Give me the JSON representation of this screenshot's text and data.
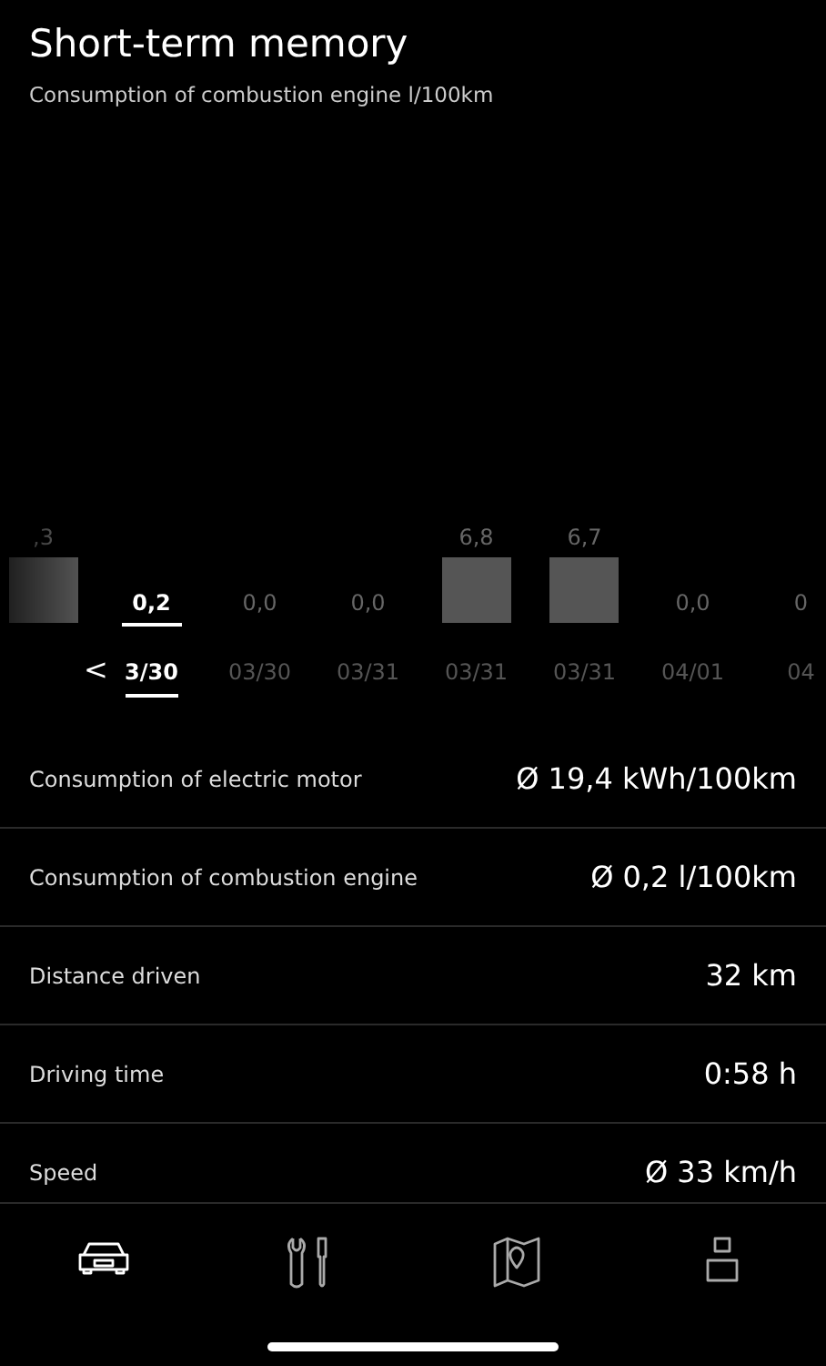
{
  "header": {
    "title": "Short-term memory",
    "subtitle": "Consumption of combustion engine l/100km"
  },
  "chart": {
    "previous_button": "<",
    "bars": [
      {
        "kind": "bar",
        "value": ",3",
        "selected": false
      },
      {
        "kind": "empty",
        "value": "0,2",
        "date": "3/30",
        "selected": true
      },
      {
        "kind": "empty",
        "value": "0,0",
        "date": "03/30",
        "selected": false
      },
      {
        "kind": "empty",
        "value": "0,0",
        "date": "03/31",
        "selected": false
      },
      {
        "kind": "bar",
        "value": "6,8",
        "date": "03/31",
        "selected": false
      },
      {
        "kind": "bar",
        "value": "6,7",
        "date": "03/31",
        "selected": false
      },
      {
        "kind": "empty",
        "value": "0,0",
        "date": "04/01",
        "selected": false
      },
      {
        "kind": "empty",
        "value": "0",
        "date": "04",
        "selected": false
      }
    ]
  },
  "stats": [
    {
      "label": "Consumption of electric motor",
      "value": "Ø 19,4 kWh/100km"
    },
    {
      "label": "Consumption of combustion engine",
      "value": "Ø 0,2 l/100km"
    },
    {
      "label": "Distance driven",
      "value": "32 km"
    },
    {
      "label": "Driving time",
      "value": "0:58 h"
    },
    {
      "label": "Speed",
      "value": "Ø 33 km/h"
    }
  ],
  "tab_bar": [
    {
      "kind": "car",
      "selected": true
    },
    {
      "kind": "tools",
      "selected": false
    },
    {
      "kind": "map",
      "selected": false
    },
    {
      "kind": "person",
      "selected": false
    }
  ]
}
